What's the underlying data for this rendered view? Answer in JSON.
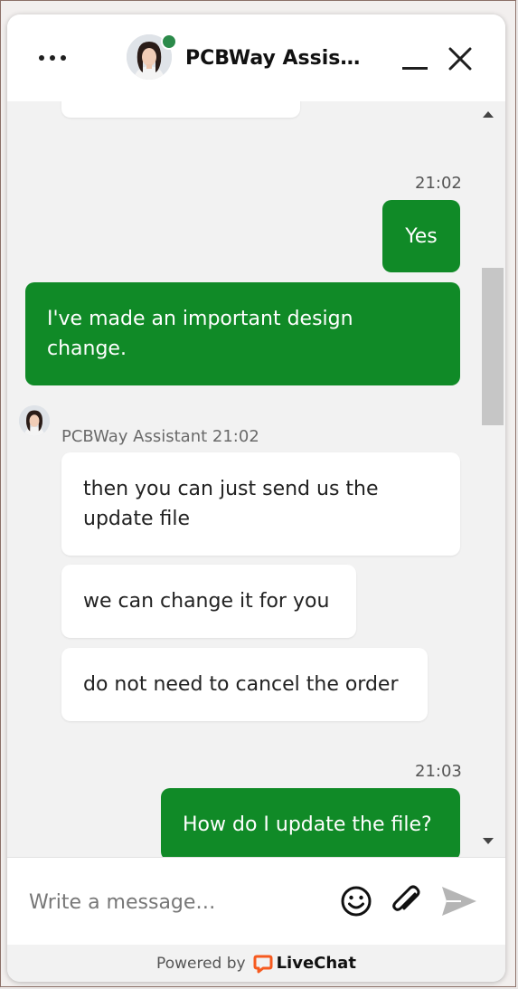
{
  "header": {
    "title": "PCBWay Assistant",
    "menu_icon": "more-horizontal-icon",
    "status": "online",
    "status_color": "#2b8a4a"
  },
  "messages": {
    "msg1_time": "21:02",
    "msg1_text": "Yes",
    "msg2_text": "I've made an important design change.",
    "agent_sender": "PCBWay Assistant 21:02",
    "agent_msg1": "then you can just send us the update file",
    "agent_msg2": "we can change it for you",
    "agent_msg3": "do not need to cancel the order",
    "msg3_time": "21:03",
    "msg3_text": "How do I update the file?"
  },
  "composer": {
    "placeholder": "Write a message…",
    "emoji_icon": "emoji-icon",
    "attach_icon": "paperclip-icon",
    "send_icon": "send-icon"
  },
  "footer": {
    "powered_by": "Powered by",
    "brand": "LiveChat",
    "brand_color": "#f65a1f"
  },
  "colors": {
    "outgoing_bubble": "#108a27",
    "incoming_bubble": "#ffffff"
  }
}
